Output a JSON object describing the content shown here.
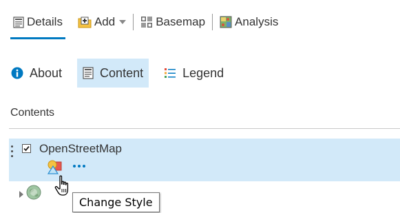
{
  "toolbar": {
    "details_label": "Details",
    "add_label": "Add",
    "basemap_label": "Basemap",
    "analysis_label": "Analysis"
  },
  "subtabs": {
    "about_label": "About",
    "content_label": "Content",
    "legend_label": "Legend"
  },
  "contents": {
    "heading": "Contents"
  },
  "layers": [
    {
      "name": "OpenStreetMap",
      "checked": true
    }
  ],
  "tooltip": {
    "text": "Change Style"
  },
  "colors": {
    "accent": "#0079c1",
    "selected_bg": "#d2e9f9",
    "divider": "#c8c8c8"
  }
}
